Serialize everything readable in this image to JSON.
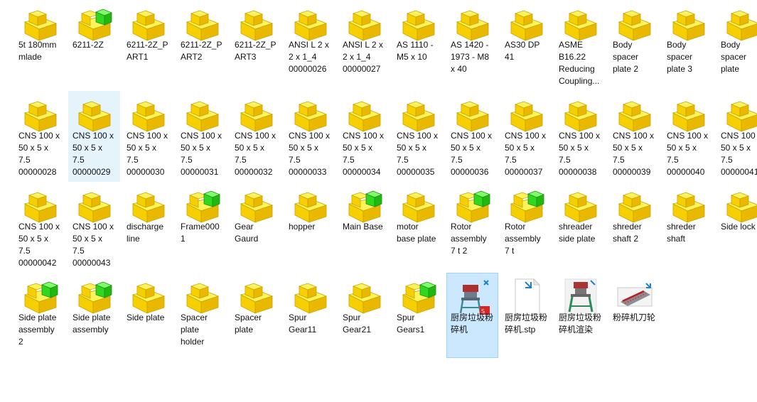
{
  "files": [
    {
      "name": "5t 180mm\nmlade",
      "icon": "sldprt-part-icon"
    },
    {
      "name": "6211-2Z",
      "icon": "sldasm-assembly-icon"
    },
    {
      "name": "6211-2Z_P\nART1",
      "icon": "sldprt-part-icon"
    },
    {
      "name": "6211-2Z_P\nART2",
      "icon": "sldprt-part-icon"
    },
    {
      "name": "6211-2Z_P\nART3",
      "icon": "sldprt-part-icon"
    },
    {
      "name": "ANSI L 2 x\n2 x 1_4\n00000026",
      "icon": "sldprt-part-icon"
    },
    {
      "name": "ANSI L 2 x\n2 x 1_4\n00000027",
      "icon": "sldprt-part-icon"
    },
    {
      "name": "AS 1110 -\nM5 x 10",
      "icon": "sldprt-part-icon"
    },
    {
      "name": "AS 1420 -\n1973 - M8\nx 40",
      "icon": "sldprt-part-icon"
    },
    {
      "name": "AS30 DP\n41",
      "icon": "sldprt-part-icon"
    },
    {
      "name": "ASME\nB16.22\nReducing\nCoupling...",
      "icon": "sldprt-part-icon"
    },
    {
      "name": "Body\nspacer\nplate 2",
      "icon": "sldprt-part-icon"
    },
    {
      "name": "Body\nspacer\nplate 3",
      "icon": "sldprt-part-icon"
    },
    {
      "name": "Body\nspacer\nplate",
      "icon": "sldprt-part-icon"
    },
    {
      "name": "CNS 100 x\n50 x 5 x\n7.5\n00000028",
      "icon": "sldprt-part-icon"
    },
    {
      "name": "CNS 100 x\n50 x 5 x\n7.5\n00000029",
      "icon": "sldprt-part-icon",
      "state": "hover"
    },
    {
      "name": "CNS 100 x\n50 x 5 x\n7.5\n00000030",
      "icon": "sldprt-part-icon"
    },
    {
      "name": "CNS 100 x\n50 x 5 x\n7.5\n00000031",
      "icon": "sldprt-part-icon"
    },
    {
      "name": "CNS 100 x\n50 x 5 x\n7.5\n00000032",
      "icon": "sldprt-part-icon"
    },
    {
      "name": "CNS 100 x\n50 x 5 x\n7.5\n00000033",
      "icon": "sldprt-part-icon"
    },
    {
      "name": "CNS 100 x\n50 x 5 x\n7.5\n00000034",
      "icon": "sldprt-part-icon"
    },
    {
      "name": "CNS 100 x\n50 x 5 x\n7.5\n00000035",
      "icon": "sldprt-part-icon"
    },
    {
      "name": "CNS 100 x\n50 x 5 x\n7.5\n00000036",
      "icon": "sldprt-part-icon"
    },
    {
      "name": "CNS 100 x\n50 x 5 x\n7.5\n00000037",
      "icon": "sldprt-part-icon"
    },
    {
      "name": "CNS 100 x\n50 x 5 x\n7.5\n00000038",
      "icon": "sldprt-part-icon"
    },
    {
      "name": "CNS 100 x\n50 x 5 x\n7.5\n00000039",
      "icon": "sldprt-part-icon"
    },
    {
      "name": "CNS 100 x\n50 x 5 x\n7.5\n00000040",
      "icon": "sldprt-part-icon"
    },
    {
      "name": "CNS 100\n50 x 5 x\n7.5\n00000041",
      "icon": "sldprt-part-icon"
    },
    {
      "name": "CNS 100 x\n50 x 5 x\n7.5\n00000042",
      "icon": "sldprt-part-icon"
    },
    {
      "name": "CNS 100 x\n50 x 5 x\n7.5\n00000043",
      "icon": "sldprt-part-icon"
    },
    {
      "name": "discharge\nline",
      "icon": "sldprt-part-icon"
    },
    {
      "name": "Frame000\n1",
      "icon": "sldasm-assembly-icon"
    },
    {
      "name": "Gear\nGaurd",
      "icon": "sldprt-part-icon"
    },
    {
      "name": "hopper",
      "icon": "sldprt-part-icon"
    },
    {
      "name": "Main Base",
      "icon": "sldasm-assembly-icon"
    },
    {
      "name": "motor\nbase plate",
      "icon": "sldprt-part-icon"
    },
    {
      "name": "Rotor\nassembly\n7 t 2",
      "icon": "sldasm-assembly-icon"
    },
    {
      "name": "Rotor\nassembly\n7 t",
      "icon": "sldasm-assembly-icon"
    },
    {
      "name": "shreader\nside plate",
      "icon": "sldprt-part-icon"
    },
    {
      "name": "shreder\nshaft 2",
      "icon": "sldprt-part-icon"
    },
    {
      "name": "shreder\nshaft",
      "icon": "sldprt-part-icon"
    },
    {
      "name": "Side lock",
      "icon": "sldprt-part-icon"
    },
    {
      "name": "Side plate\nassembly\n2",
      "icon": "sldasm-assembly-icon"
    },
    {
      "name": "Side plate\nassembly",
      "icon": "sldasm-assembly-icon"
    },
    {
      "name": "Side plate",
      "icon": "sldprt-part-icon"
    },
    {
      "name": "Spacer\nplate\nholder",
      "icon": "sldprt-part-icon"
    },
    {
      "name": "Spacer\nplate",
      "icon": "sldprt-part-icon"
    },
    {
      "name": "Spur\nGear11",
      "icon": "sldprt-part-icon"
    },
    {
      "name": "Spur\nGear21",
      "icon": "sldprt-part-icon"
    },
    {
      "name": "Spur\nGears1",
      "icon": "sldasm-assembly-icon"
    },
    {
      "name": "厨房垃圾粉\n碎机",
      "icon": "machine-preview-sw-icon",
      "state": "selected"
    },
    {
      "name": "厨房垃圾粉\n碎机.stp",
      "icon": "stp-file-icon"
    },
    {
      "name": "厨房垃圾粉\n碎机渲染",
      "icon": "machine-render-icon"
    },
    {
      "name": "粉碎机刀轮",
      "icon": "blade-wheel-icon"
    }
  ]
}
